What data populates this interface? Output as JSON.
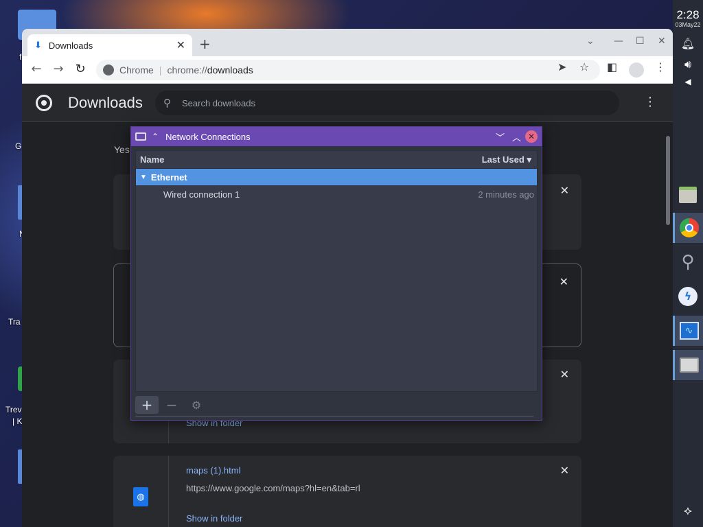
{
  "desktop": {
    "labels": [
      "f",
      "G",
      "N",
      "Tra",
      "Trev",
      "| K"
    ]
  },
  "taskbar": {
    "time": "2:28",
    "date": "03May22",
    "icons": [
      "bell-icon",
      "volume-icon",
      "collapse-icon",
      "files-icon",
      "chrome-icon",
      "search-icon",
      "app-icon",
      "monitor-icon",
      "network-icon"
    ]
  },
  "chrome": {
    "tab_title": "Downloads",
    "omnibox": {
      "chip": "Chrome",
      "url_scheme": "chrome://",
      "url_host": "downloads"
    }
  },
  "downloads_page": {
    "title": "Downloads",
    "search_placeholder": "Search downloads",
    "date_header": "Yes",
    "items": [
      {
        "name": "maps (1).html",
        "url": "https://www.google.com/maps?hl=en&tab=rl",
        "action": "Show in folder"
      },
      {
        "action": "Show in folder"
      }
    ]
  },
  "network_dialog": {
    "title": "Network Connections",
    "columns": {
      "name": "Name",
      "last_used": "Last Used"
    },
    "group": "Ethernet",
    "connections": [
      {
        "name": "Wired connection 1",
        "last_used": "2 minutes ago"
      }
    ],
    "buttons": {
      "add": "+",
      "remove": "−",
      "settings": "⚙"
    }
  }
}
